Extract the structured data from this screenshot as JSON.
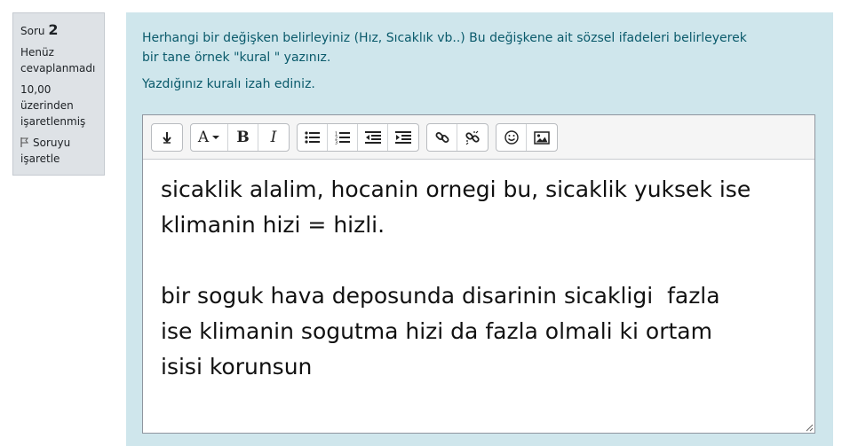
{
  "question_info": {
    "label": "Soru",
    "number": "2",
    "state_line1": "Henüz",
    "state_line2": "cevaplanmadı",
    "grade_line1": "10,00",
    "grade_line2": "üzerinden",
    "grade_line3": "işaretlenmiş",
    "flag_line1": "Soruyu",
    "flag_line2": "işaretle"
  },
  "question": {
    "text_line1": "Herhangi bir değişken belirleyiniz (Hız, Sıcaklık vb..)  Bu değişkene ait sözsel ifadeleri belirleyerek",
    "text_line2": "bir tane örnek \"kural \" yazınız.",
    "text_line3": "Yazdığınız kuralı izah ediniz."
  },
  "toolbar": {
    "icons": [
      "collapse-icon",
      "font-color-icon",
      "bold-icon",
      "italic-icon",
      "unordered-list-icon",
      "ordered-list-icon",
      "outdent-icon",
      "indent-icon",
      "link-icon",
      "unlink-icon",
      "emoji-icon",
      "image-icon"
    ],
    "font_label": "A",
    "bold_label": "B",
    "italic_label": "I"
  },
  "answer": {
    "line1": "sicaklik alalim, hocanin ornegi bu, sicaklik yuksek ise",
    "line2": "klimanin hizi = hizli.",
    "line3": "bir soguk hava deposunda disarinin sicakligi  fazla",
    "line4": "ise klimanin sogutma hizi da fazla olmali ki ortam",
    "line5": "isisi korunsun"
  }
}
